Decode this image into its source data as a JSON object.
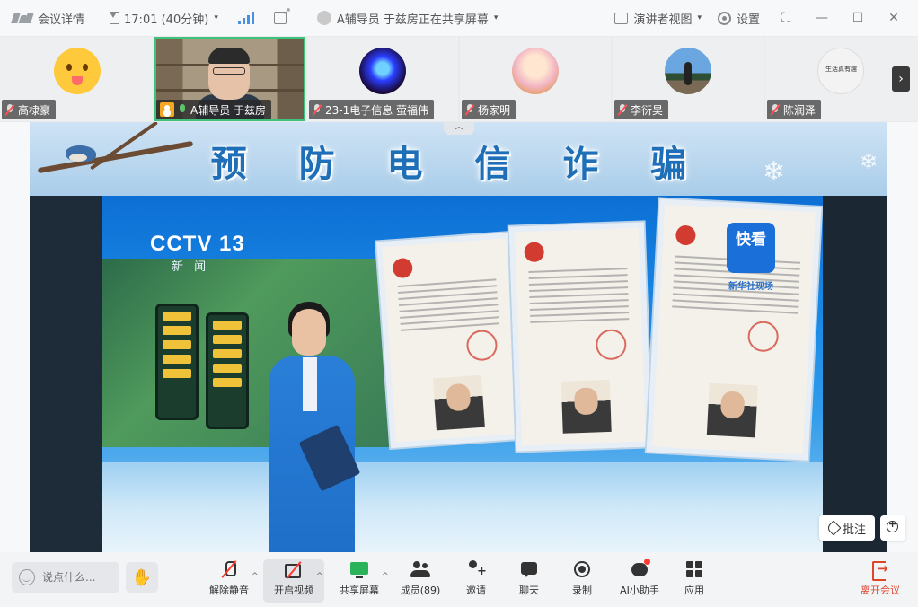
{
  "titlebar": {
    "meeting_details": "会议详情",
    "elapsed": "17:01 (40分钟)",
    "sharing_status": "A辅导员 于兹房正在共享屏幕",
    "presenter_view": "演讲者视图",
    "settings": "设置"
  },
  "participants": [
    {
      "name": "高棣豪"
    },
    {
      "name": "A辅导员 于兹房"
    },
    {
      "name": "23-1电子信息 萤福伟"
    },
    {
      "name": "杨家明"
    },
    {
      "name": "李衍昊"
    },
    {
      "name": "陈润泽",
      "avatar_text": "生活真有趣"
    }
  ],
  "slide": {
    "title": "预 防 电 信 诈 骗",
    "broadcast_logo": "CCTV 13",
    "broadcast_sub": "新 闻",
    "app_badge": "快看",
    "app_badge_sub": "新华社现场"
  },
  "overlay": {
    "annotate_label": "批注"
  },
  "toolbar": {
    "chat_placeholder": "说点什么...",
    "unmute": "解除静音",
    "start_video": "开启视频",
    "share_screen": "共享屏幕",
    "members": "成员(89)",
    "invite": "邀请",
    "chat": "聊天",
    "record": "录制",
    "ai_assistant": "AI小助手",
    "apps": "应用",
    "leave": "离开会议"
  },
  "colors": {
    "accent_green": "#3fc37a",
    "leave_red": "#e0452b",
    "title_blue": "#1f6fb8"
  }
}
